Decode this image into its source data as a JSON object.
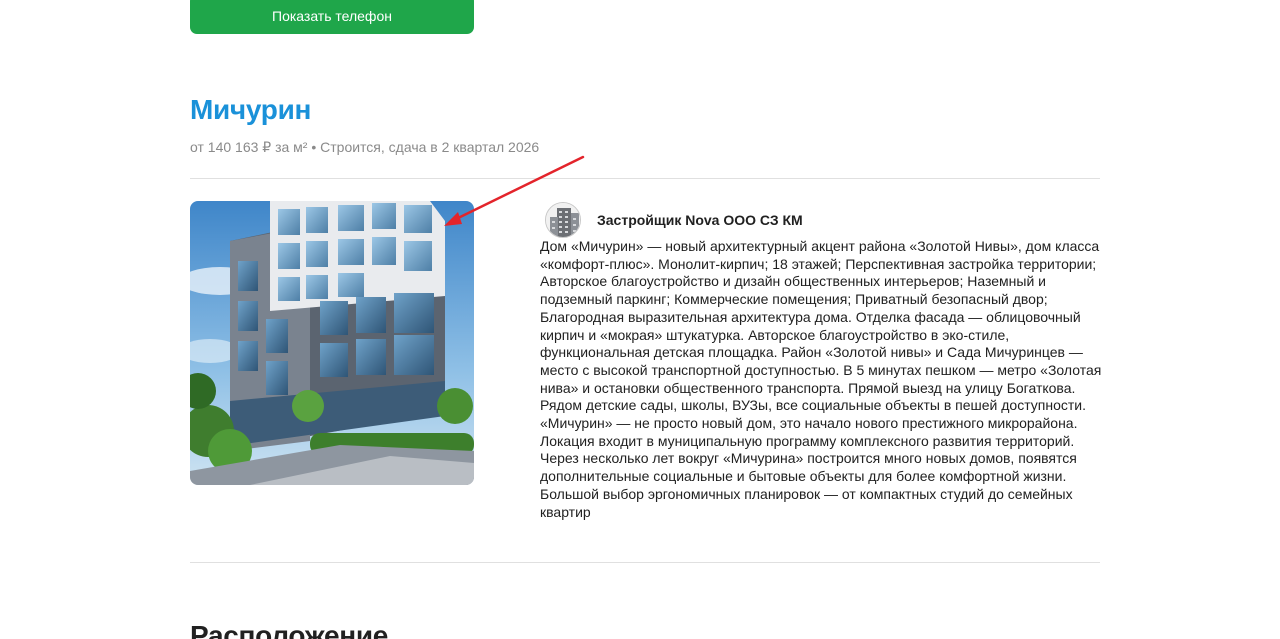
{
  "actions": {
    "show_phone_label": "Показать телефон"
  },
  "project": {
    "title": "Мичурин",
    "meta": "от 140 163 ₽ за м² • Строится, сдача в 2 квартал 2026"
  },
  "developer": {
    "name": "Застройщик Nova ООО СЗ КМ",
    "logo_icon": "building-icon"
  },
  "description": "Дом «Мичурин» — новый архитектурный акцент района «Золотой Нивы», дом класса «комфорт-плюс». Монолит-кирпич; 18 этажей; Перспективная застройка территории; Авторское благоустройство и дизайн общественных интерьеров; Наземный и подземный паркинг; Коммерческие помещения; Приватный безопасный двор; Благородная выразительная архитектура дома. Отделка фасада — облицовочный кирпич и «мокрая» штукатурка. Авторское благоустройство в эко-стиле, функциональная детская площадка. Район «Золотой нивы» и Сада Мичуринцев — место с высокой транспортной доступностью. В 5 минутах пешком — метро «Золотая нива» и остановки общественного транспорта. Прямой выезд на улицу Богаткова. Рядом детские сады, школы, ВУЗы, все социальные объекты в пешей доступности. «Мичурин» — не просто новый дом, это начало нового престижного микрорайона. Локация входит в муниципальную программу комплексного развития территорий. Через несколько лет вокруг «Мичурина» построится много новых домов, появятся дополнительные социальные и бытовые объекты для более комфортной жизни. Большой выбор эргономичных планировок — от компактных студий до семейных квартир",
  "next_section": {
    "title": "Расположение"
  },
  "colors": {
    "accent_green": "#1fa64a",
    "title_blue": "#1a91d9",
    "annotation_red": "#e3242b"
  }
}
